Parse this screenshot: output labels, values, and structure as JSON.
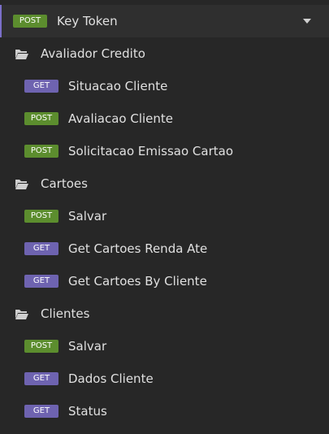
{
  "top": {
    "method": "POST",
    "label": "Key Token"
  },
  "folders": [
    {
      "name": "Avaliador Credito",
      "items": [
        {
          "method": "GET",
          "label": "Situacao Cliente"
        },
        {
          "method": "POST",
          "label": "Avaliacao Cliente"
        },
        {
          "method": "POST",
          "label": "Solicitacao Emissao Cartao"
        }
      ]
    },
    {
      "name": "Cartoes",
      "items": [
        {
          "method": "POST",
          "label": "Salvar"
        },
        {
          "method": "GET",
          "label": "Get Cartoes Renda Ate"
        },
        {
          "method": "GET",
          "label": "Get Cartoes By Cliente"
        }
      ]
    },
    {
      "name": "Clientes",
      "items": [
        {
          "method": "POST",
          "label": "Salvar"
        },
        {
          "method": "GET",
          "label": "Dados Cliente"
        },
        {
          "method": "GET",
          "label": "Status"
        }
      ]
    }
  ],
  "colors": {
    "background": "#272727",
    "post": "#5c8d2e",
    "get": "#6e63b0",
    "active_accent": "#7b6fc9"
  }
}
